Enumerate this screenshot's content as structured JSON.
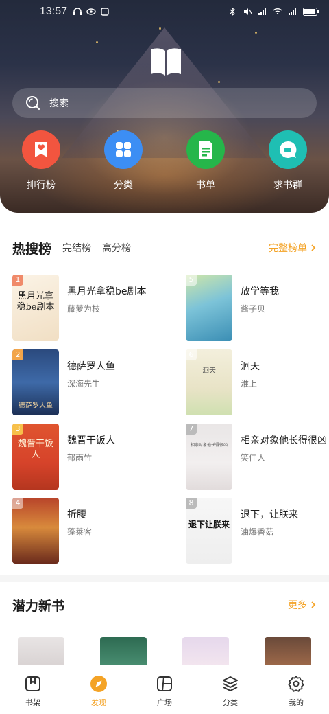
{
  "status_bar": {
    "time": "13:57"
  },
  "search": {
    "placeholder": "搜索"
  },
  "quick_actions": [
    {
      "label": "排行榜",
      "icon": "ribbon-heart-icon",
      "color": "#f2553f"
    },
    {
      "label": "分类",
      "icon": "grid-icon",
      "color": "#3c8ef4"
    },
    {
      "label": "书单",
      "icon": "book-list-icon",
      "color": "#25b64a"
    },
    {
      "label": "求书群",
      "icon": "chat-bubble-icon",
      "color": "#1fbfb3"
    }
  ],
  "hot_search": {
    "title": "热搜榜",
    "tabs": [
      "完结榜",
      "高分榜"
    ],
    "more_label": "完整榜单",
    "items": [
      {
        "rank": "1",
        "name": "黑月光拿稳be剧本",
        "author": "藤萝为枝",
        "cover_text": "黑月光拿稳be剧本"
      },
      {
        "rank": "2",
        "name": "德萨罗人鱼",
        "author": "深海先生",
        "cover_text": "德萨罗人鱼"
      },
      {
        "rank": "3",
        "name": "魏晋干饭人",
        "author": "郁雨竹",
        "cover_text": "魏晋干饭人"
      },
      {
        "rank": "4",
        "name": "折腰",
        "author": "蓬莱客",
        "cover_text": ""
      },
      {
        "rank": "5",
        "name": "放学等我",
        "author": "酱子贝",
        "cover_text": ""
      },
      {
        "rank": "6",
        "name": "洄天",
        "author": "淮上",
        "cover_text": "洄天"
      },
      {
        "rank": "7",
        "name": "相亲对象他长得很凶",
        "author": "笑佳人",
        "cover_text": "相亲对象他长得很凶"
      },
      {
        "rank": "8",
        "name": "退下，让朕来",
        "author": "油爆香菇",
        "cover_text": "退下让朕来"
      }
    ]
  },
  "new_books": {
    "title": "潜力新书",
    "more_label": "更多"
  },
  "tab_bar": [
    {
      "label": "书架",
      "icon": "bookshelf-icon",
      "active": false
    },
    {
      "label": "发现",
      "icon": "discover-compass-icon",
      "active": true
    },
    {
      "label": "广场",
      "icon": "square-plaza-icon",
      "active": false
    },
    {
      "label": "分类",
      "icon": "layers-icon",
      "active": false
    },
    {
      "label": "我的",
      "icon": "settings-gear-icon",
      "active": false
    }
  ],
  "colors": {
    "accent": "#f4a326",
    "text": "#1c1c1c",
    "muted": "#777777"
  }
}
